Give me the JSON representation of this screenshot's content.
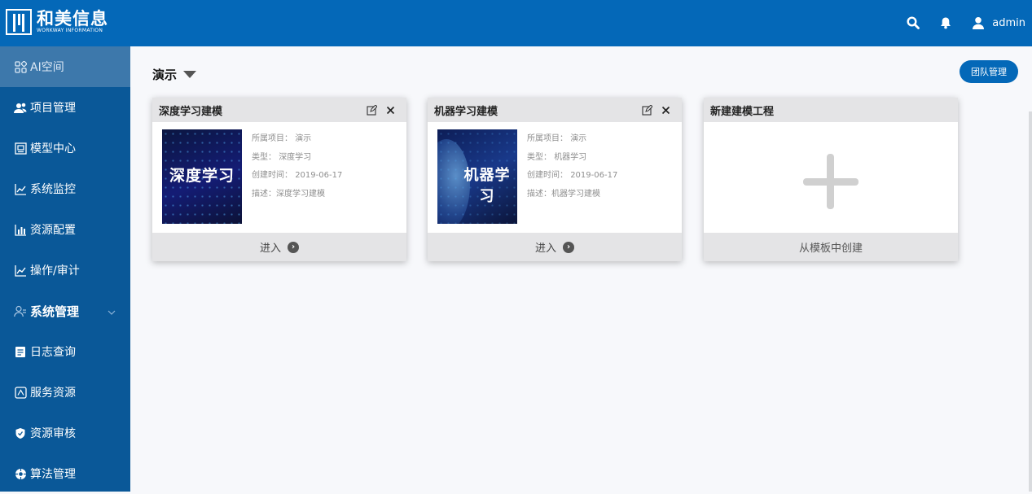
{
  "header": {
    "logo_cn": "和美信息",
    "logo_en": "WORKWAY INFORMATION",
    "icons": [
      "search-icon",
      "bell-icon",
      "user-icon"
    ],
    "user": "admin"
  },
  "sidebar": {
    "items": [
      {
        "label": "AI空间",
        "icon": "grid-icon"
      },
      {
        "label": "项目管理",
        "icon": "users-icon"
      },
      {
        "label": "模型中心",
        "icon": "model-icon"
      },
      {
        "label": "系统监控",
        "icon": "line-chart-icon"
      },
      {
        "label": "资源配置",
        "icon": "bar-chart-icon"
      },
      {
        "label": "操作/审计",
        "icon": "line-chart-icon"
      },
      {
        "label": "系统管理",
        "icon": "user-settings-icon"
      },
      {
        "label": "日志查询",
        "icon": "document-icon"
      },
      {
        "label": "服务资源",
        "icon": "service-icon"
      },
      {
        "label": "资源审核",
        "icon": "shield-icon"
      },
      {
        "label": "算法管理",
        "icon": "algorithm-icon"
      }
    ]
  },
  "workspace": {
    "title": "演示",
    "team_button": "团队管理"
  },
  "cards": [
    {
      "title": "深度学习建模",
      "thumb_text": "深度学习",
      "project_label": "所属项目：",
      "project": "演示",
      "type_label": "类型：",
      "type": "深度学习",
      "created_label": "创建时间：",
      "created": "2019-06-17",
      "desc_label": "描述：",
      "desc": "深度学习建模",
      "enter": "进入"
    },
    {
      "title": "机器学习建模",
      "thumb_text": "机器学习",
      "project_label": "所属项目：",
      "project": "演示",
      "type_label": "类型：",
      "type": "机器学习",
      "created_label": "创建时间：",
      "created": "2019-06-17",
      "desc_label": "描述：",
      "desc": "机器学习建模",
      "enter": "进入"
    }
  ],
  "new_card": {
    "title": "新建建模工程",
    "footer": "从模板中创建"
  },
  "colors": {
    "header": "#0468b8",
    "sidebar": "#0a5898",
    "sidebar_active": "#3d78ab",
    "card_header": "#e4e4e6"
  }
}
